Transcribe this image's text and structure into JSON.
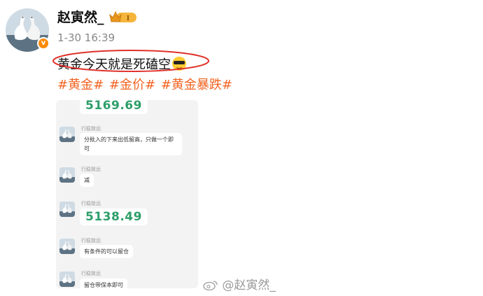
{
  "post": {
    "username": "赵寅然_",
    "vip_level": "I",
    "time": "1-30 16:39",
    "text": "黄金今天就是死磕空",
    "emoji": "sunglasses-emoji",
    "hashtags": [
      "#黄金#",
      "#金价#",
      "#黄金暴跌#"
    ]
  },
  "colors": {
    "hashtag": "#f26322",
    "highlight": "#e0312b",
    "price": "#2e9e6a",
    "verified": "#ff8a00"
  },
  "chat": {
    "messages": [
      {
        "sender": "",
        "text": "5169.69",
        "kind": "price"
      },
      {
        "sender": "行稳致远",
        "text": "分批入的下来出低留高，只做一个即可",
        "kind": "text"
      },
      {
        "sender": "行稳致远",
        "text": "减",
        "kind": "text"
      },
      {
        "sender": "行稳致远",
        "text": "5138.49",
        "kind": "price"
      },
      {
        "sender": "行稳致远",
        "text": "有条件的可以留仓",
        "kind": "text"
      },
      {
        "sender": "行稳致远",
        "text": "留仓带保本即可",
        "kind": "text"
      }
    ]
  },
  "watermark": "@赵寅然_"
}
